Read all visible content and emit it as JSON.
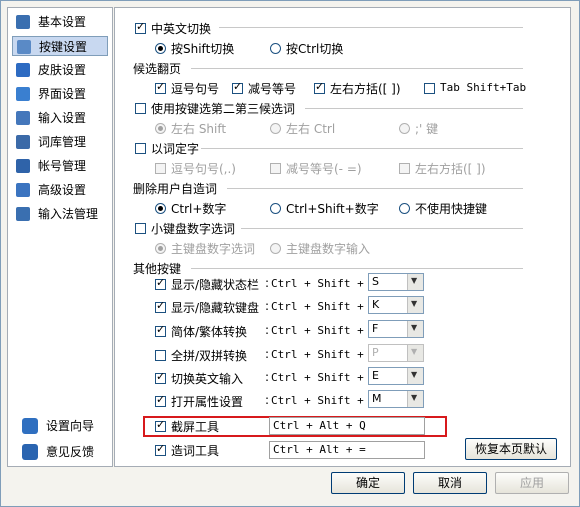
{
  "sidebar": {
    "items": [
      {
        "label": "基本设置",
        "icon": "wrench-icon",
        "selected": false
      },
      {
        "label": "按键设置",
        "icon": "keyboard-icon",
        "selected": true
      },
      {
        "label": "皮肤设置",
        "icon": "shirt-icon",
        "selected": false
      },
      {
        "label": "界面设置",
        "icon": "window-icon",
        "selected": false
      },
      {
        "label": "输入设置",
        "icon": "input-icon",
        "selected": false
      },
      {
        "label": "词库管理",
        "icon": "book-icon",
        "selected": false
      },
      {
        "label": "帐号管理",
        "icon": "account-icon",
        "selected": false
      },
      {
        "label": "高级设置",
        "icon": "advanced-icon",
        "selected": false
      },
      {
        "label": "输入法管理",
        "icon": "ime-manage-icon",
        "selected": false
      }
    ],
    "bottom": [
      {
        "label": "设置向导",
        "icon": "gear-wizard-icon"
      },
      {
        "label": "意见反馈",
        "icon": "feedback-icon"
      }
    ]
  },
  "panel": {
    "cn_en_switch": {
      "label": "中英文切换",
      "checked": true,
      "options": [
        {
          "label": "按Shift切换",
          "selected": true
        },
        {
          "label": "按Ctrl切换",
          "selected": false
        }
      ]
    },
    "candidate_paging": {
      "title": "候选翻页",
      "options": [
        {
          "label": "逗号句号",
          "checked": true
        },
        {
          "label": "减号等号",
          "checked": true
        },
        {
          "label": "左右方括([ ])",
          "checked": true
        },
        {
          "label": "Tab Shift+Tab",
          "checked": false
        }
      ]
    },
    "select_second_third": {
      "label": "使用按键选第二第三候选词",
      "checked": false,
      "options": [
        {
          "label": "左右 Shift"
        },
        {
          "label": "左右 Ctrl"
        },
        {
          "label": ";' 键"
        }
      ]
    },
    "word_to_char": {
      "label": "以词定字",
      "checked": false,
      "options": [
        {
          "label": "逗号句号(,.)"
        },
        {
          "label": "减号等号(- =)"
        },
        {
          "label": "左右方括([ ])"
        }
      ]
    },
    "delete_user_words": {
      "title": "删除用户自造词",
      "options": [
        {
          "label": "Ctrl+数字",
          "selected": true
        },
        {
          "label": "Ctrl+Shift+数字",
          "selected": false
        },
        {
          "label": "不使用快捷键",
          "selected": false
        }
      ]
    },
    "numpad": {
      "label": "小键盘数字选词",
      "checked": false,
      "options": [
        {
          "label": "主键盘数字选词",
          "selected": true
        },
        {
          "label": "主键盘数字输入",
          "selected": false
        }
      ]
    },
    "other_keys": {
      "title": "其他按键",
      "items": [
        {
          "label": "显示/隐藏状态栏",
          "colon": ":",
          "combo": "Ctrl + Shift +",
          "key": "S",
          "checked": true
        },
        {
          "label": "显示/隐藏软键盘",
          "colon": ":",
          "combo": "Ctrl + Shift +",
          "key": "K",
          "checked": true
        },
        {
          "label": "简体/繁体转换",
          "colon": ":",
          "combo": "Ctrl + Shift +",
          "key": "F",
          "checked": true
        },
        {
          "label": "全拼/双拼转换",
          "colon": ":",
          "combo": "Ctrl + Shift +",
          "key": "P",
          "checked": false
        },
        {
          "label": "切换英文输入",
          "colon": ":",
          "combo": "Ctrl + Shift +",
          "key": "E",
          "checked": true
        },
        {
          "label": "打开属性设置",
          "colon": ":",
          "combo": "Ctrl + Shift +",
          "key": "M",
          "checked": true
        }
      ],
      "screenshot": {
        "label": "截屏工具",
        "value": "Ctrl + Alt + Q",
        "checked": true
      },
      "word_maker": {
        "label": "造词工具",
        "value": "Ctrl + Alt + =",
        "checked": true
      },
      "restore_label": "恢复本页默认"
    }
  },
  "footer": {
    "ok": "确定",
    "cancel": "取消",
    "apply": "应用"
  },
  "colors": {
    "highlight_border": "#d7191c",
    "selected_nav": "#c8d8f0"
  }
}
